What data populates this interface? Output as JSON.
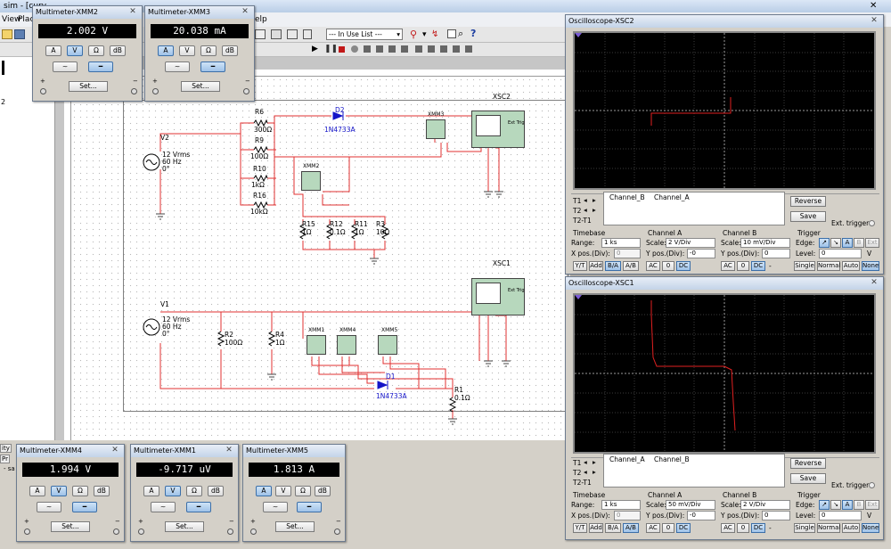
{
  "app": {
    "title": "sim - [curv",
    "menu": [
      "View",
      "Plac",
      "elp"
    ],
    "in_use_list": "--- In Use List ---"
  },
  "left_panel": {
    "items": [
      "2"
    ]
  },
  "bottom_tabs": [
    "ity",
    "Pr"
  ],
  "bottom_text": "- sa",
  "circuit": {
    "labels": {
      "R6": "R6",
      "R6v": "300Ω",
      "R9": "R9",
      "R9v": "100Ω",
      "R10": "R10",
      "R10v": "1kΩ",
      "R16": "R16",
      "R16v": "10kΩ",
      "D2": "D2",
      "D2v": "1N4733A",
      "D1": "D1",
      "D1v": "1N4733A",
      "R15": "R15",
      "R15v": "1Ω",
      "R12": "R12",
      "R12v": "0.1Ω",
      "R11": "R11",
      "R11v": "1Ω",
      "R3": "R3",
      "R3v": "10Ω",
      "R2": "R2",
      "R2v": "100Ω",
      "R4": "R4",
      "R4v": "1Ω",
      "R1": "R1",
      "R1v": "0.1Ω",
      "V2": "V2",
      "V2a": "12 Vrms",
      "V2b": "60 Hz",
      "V2c": "0°",
      "V1": "V1",
      "V1a": "12 Vrms",
      "V1b": "60 Hz",
      "V1c": "0°",
      "XMM1": "XMM1",
      "XMM2": "XMM2",
      "XMM3": "XMM3",
      "XMM4": "XMM4",
      "XMM5": "XMM5",
      "XSC1": "XSC1",
      "XSC2": "XSC2",
      "ext_trig": "Ext Trig"
    }
  },
  "multimeters": [
    {
      "id": "xmm2",
      "title": "Multimeter-XMM2",
      "value": "2.002 V",
      "active": "V"
    },
    {
      "id": "xmm3",
      "title": "Multimeter-XMM3",
      "value": "20.038 mA",
      "active": "A"
    },
    {
      "id": "xmm4",
      "title": "Multimeter-XMM4",
      "value": "1.994 V",
      "active": "V"
    },
    {
      "id": "xmm1",
      "title": "Multimeter-XMM1",
      "value": "-9.717 uV",
      "active": "V"
    },
    {
      "id": "xmm5",
      "title": "Multimeter-XMM5",
      "value": "1.813 A",
      "active": "A"
    }
  ],
  "multimeter_common": {
    "btn_a": "A",
    "btn_v": "V",
    "btn_ohm": "Ω",
    "btn_db": "dB",
    "set": "Set...",
    "plus": "+",
    "minus": "−"
  },
  "scopes": [
    {
      "id": "xsc2",
      "title": "Oscilloscope-XSC2",
      "t1": "T1",
      "t2": "T2",
      "t2t1": "T2-T1",
      "cursor_cols": [
        "Channel_B",
        "Channel_A"
      ],
      "reverse": "Reverse",
      "save": "Save",
      "ext_trigger": "Ext. trigger",
      "timebase": {
        "title": "Timebase",
        "range_label": "Range:",
        "range": "1 ks",
        "xpos_label": "X pos.(Div):",
        "xpos": "0",
        "modes": [
          "Y/T",
          "Add",
          "B/A",
          "A/B"
        ],
        "mode_active": "B/A"
      },
      "channel_a": {
        "title": "Channel A",
        "scale_label": "Scale:",
        "scale": "2  V/Div",
        "ypos_label": "Y pos.(Div):",
        "ypos": "-0",
        "coupling": [
          "AC",
          "0",
          "DC"
        ],
        "coupling_active": "DC"
      },
      "channel_b": {
        "title": "Channel B",
        "scale_label": "Scale:",
        "scale": "10 mV/Div",
        "ypos_label": "Y pos.(Div):",
        "ypos": "0",
        "coupling": [
          "AC",
          "0",
          "DC"
        ],
        "coupling_active": "DC",
        "minus": "-"
      },
      "trigger": {
        "title": "Trigger",
        "edge_label": "Edge:",
        "level_label": "Level:",
        "level": "0",
        "unit": "V",
        "sources": [
          "A",
          "B",
          "Ext"
        ],
        "source_active": "A",
        "modes": [
          "Single",
          "Normal",
          "Auto",
          "None"
        ],
        "mode_active": "None"
      }
    },
    {
      "id": "xsc1",
      "title": "Oscilloscope-XSC1",
      "t1": "T1",
      "t2": "T2",
      "t2t1": "T2-T1",
      "cursor_cols": [
        "Channel_A",
        "Channel_B"
      ],
      "reverse": "Reverse",
      "save": "Save",
      "ext_trigger": "Ext. trigger",
      "timebase": {
        "title": "Timebase",
        "range_label": "Range:",
        "range": "1 ks",
        "xpos_label": "X pos.(Div):",
        "xpos": "0",
        "modes": [
          "Y/T",
          "Add",
          "B/A",
          "A/B"
        ],
        "mode_active": "A/B"
      },
      "channel_a": {
        "title": "Channel A",
        "scale_label": "Scale:",
        "scale": "50 mV/Div",
        "ypos_label": "Y pos.(Div):",
        "ypos": "-0",
        "coupling": [
          "AC",
          "0",
          "DC"
        ],
        "coupling_active": "DC"
      },
      "channel_b": {
        "title": "Channel B",
        "scale_label": "Scale:",
        "scale": "2  V/Div",
        "ypos_label": "Y pos.(Div):",
        "ypos": "0",
        "coupling": [
          "AC",
          "0",
          "DC"
        ],
        "coupling_active": "DC",
        "minus": "-"
      },
      "trigger": {
        "title": "Trigger",
        "edge_label": "Edge:",
        "level_label": "Level:",
        "level": "0",
        "unit": "V",
        "sources": [
          "A",
          "B",
          "Ext"
        ],
        "source_active": "A",
        "modes": [
          "Single",
          "Normal",
          "Auto",
          "None"
        ],
        "mode_active": "None"
      }
    }
  ],
  "colors": {
    "wire": "#e03030",
    "trace": "#e02020",
    "component_blue": "#1414c8",
    "instrument_green": "#b7d8bd",
    "active_button": "#9fc2e8"
  }
}
